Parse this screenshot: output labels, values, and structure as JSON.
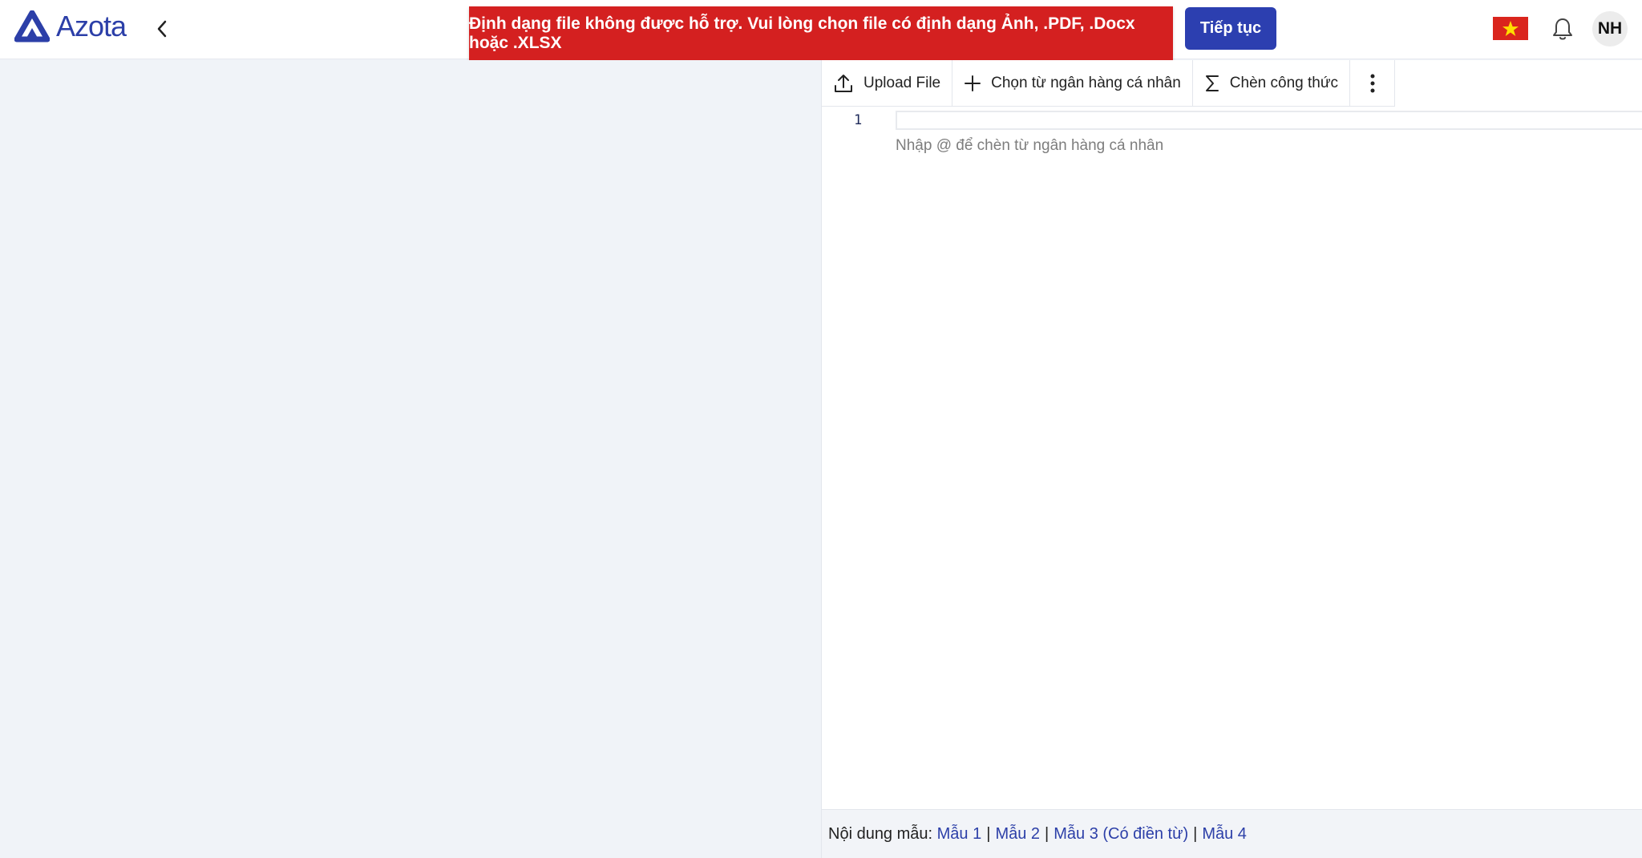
{
  "header": {
    "logo_text": "Azota",
    "back_icon": "chevron-left-icon",
    "continue_label": "Tiếp tục",
    "language_flag": "vietnam-flag-icon",
    "notification_icon": "bell-icon",
    "avatar_initials": "NH"
  },
  "toast": {
    "message": "Định dạng file không được hỗ trợ. Vui lòng chọn file có định dạng Ảnh, .PDF, .Docx hoặc .XLSX",
    "color": "#d42020"
  },
  "toolbar": {
    "upload_label": "Upload File",
    "choose_label": "Chọn từ ngân hàng cá nhân",
    "formula_label": "Chèn công thức",
    "more_icon": "more-vertical-icon"
  },
  "editor": {
    "line_number": "1",
    "hint": "Nhập @ để chèn từ ngân hàng cá nhân"
  },
  "footer": {
    "label": "Nội dung mẫu:",
    "samples": [
      "Mẫu 1",
      "Mẫu 2",
      "Mẫu 3 (Có điền từ)",
      "Mẫu 4"
    ],
    "separator": "|"
  },
  "colors": {
    "accent": "#2c3fb0",
    "error": "#d42020",
    "link": "#2c3fa8"
  }
}
